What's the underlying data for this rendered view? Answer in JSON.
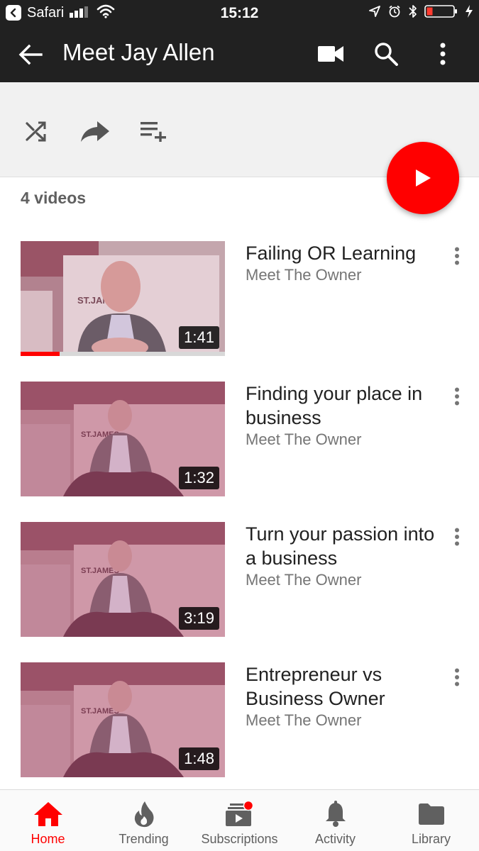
{
  "status_bar": {
    "app": "Safari",
    "time": "15:12"
  },
  "app_bar": {
    "title": "Meet Jay Allen",
    "icons": [
      "back-arrow-icon",
      "camera-icon",
      "search-icon",
      "more-vert-icon"
    ]
  },
  "actions": {
    "icons": [
      "shuffle-icon",
      "share-icon",
      "add-to-playlist-icon",
      "play-all-icon"
    ]
  },
  "playlist": {
    "count_label": "4 videos"
  },
  "videos": [
    {
      "title": "Failing OR Learning",
      "channel": "Meet The Owner",
      "duration": "1:41",
      "watched_fraction": 0.19
    },
    {
      "title": "Finding your place in business",
      "channel": "Meet The Owner",
      "duration": "1:32"
    },
    {
      "title": "Turn your passion into a business",
      "channel": "Meet The Owner",
      "duration": "3:19"
    },
    {
      "title": "Entrepreneur vs Business Owner",
      "channel": "Meet The Owner",
      "duration": "1:48"
    }
  ],
  "bottom_nav": [
    {
      "label": "Home",
      "icon": "home-icon",
      "active": true
    },
    {
      "label": "Trending",
      "icon": "flame-icon"
    },
    {
      "label": "Subscriptions",
      "icon": "subscriptions-icon",
      "badge": true
    },
    {
      "label": "Activity",
      "icon": "bell-icon"
    },
    {
      "label": "Library",
      "icon": "folder-icon"
    }
  ],
  "colors": {
    "accent": "#ff0000",
    "app_bar": "#212121",
    "action_strip": "#f1f1f1"
  }
}
